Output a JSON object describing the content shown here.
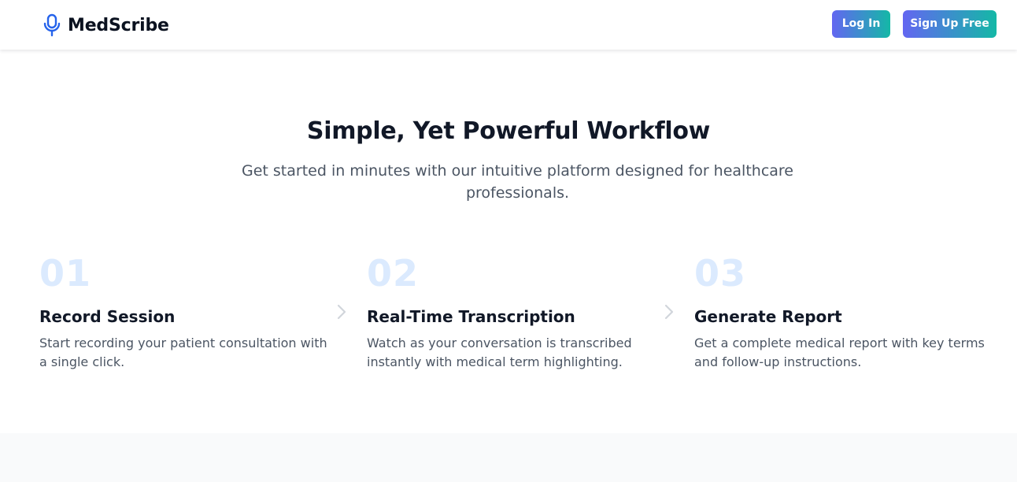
{
  "header": {
    "brand_name": "MedScribe",
    "brand_icon": "microphone-icon",
    "login_label": "Log In",
    "signup_label": "Sign Up Free"
  },
  "workflow": {
    "title": "Simple, Yet Powerful Workflow",
    "subtitle": "Get started in minutes with our intuitive platform designed for healthcare professionals.",
    "steps": [
      {
        "number": "01",
        "title": "Record Session",
        "description": "Start recording your patient consultation with a single click."
      },
      {
        "number": "02",
        "title": "Real-Time Transcription",
        "description": "Watch as your conversation is transcribed instantly with medical term highlighting."
      },
      {
        "number": "03",
        "title": "Generate Report",
        "description": "Get a complete medical report with key terms and follow-up instructions."
      }
    ],
    "separator_icon": "chevron-right-icon"
  },
  "colors": {
    "brand_blue": "#2563eb",
    "button_gradient_start": "#6366f1",
    "button_gradient_end": "#14b8a6",
    "step_number": "#dbeafe",
    "heading": "#111827",
    "body_text": "#4b5563",
    "footer_band": "#f9fafb"
  }
}
